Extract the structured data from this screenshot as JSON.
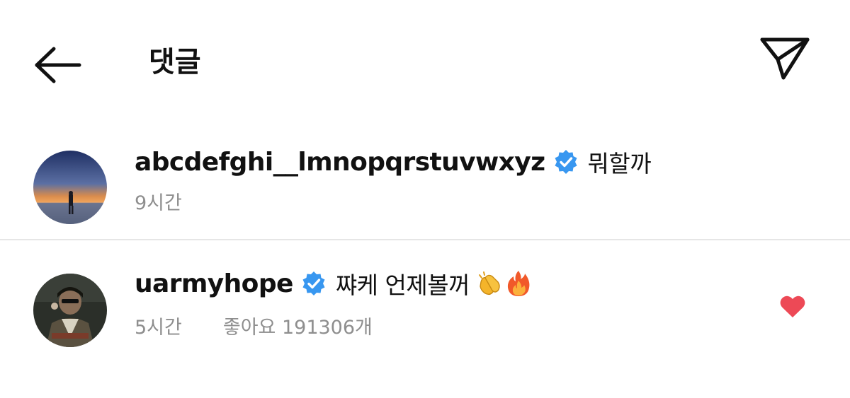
{
  "header": {
    "title": "댓글",
    "back_icon": "arrow-left-icon",
    "send_icon": "paper-plane-icon"
  },
  "comments": [
    {
      "username": "abcdefghi__lmnopqrstuvwxyz",
      "verified": true,
      "text": "뭐할까",
      "time": "9시간",
      "likes": ""
    },
    {
      "username": "uarmyhope",
      "verified": true,
      "text": "쨔케 언제볼꺼",
      "emojis": [
        "clapping-hands-emoji",
        "fire-emoji"
      ],
      "time": "5시간",
      "likes": "좋아요 191306개",
      "liked": true
    }
  ],
  "colors": {
    "verified_blue": "#3897f0",
    "heart_red": "#ed4956",
    "meta_gray": "#8e8e8e",
    "divider": "#e6e6e6"
  }
}
